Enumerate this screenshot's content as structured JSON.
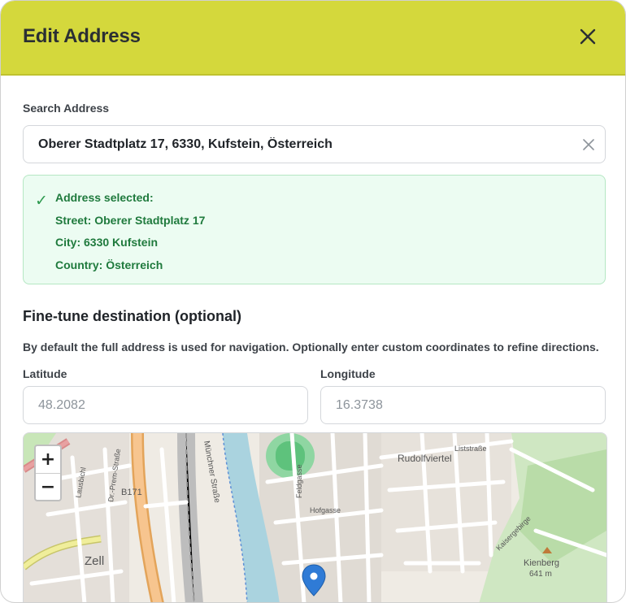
{
  "dialog": {
    "title": "Edit Address",
    "close_icon": "close-icon"
  },
  "search": {
    "label": "Search Address",
    "value": "Oberer Stadtplatz 17, 6330, Kufstein, Österreich",
    "clear_icon": "clear-icon"
  },
  "selection": {
    "heading": "Address selected:",
    "street": "Street: Oberer Stadtplatz 17",
    "city": "City: 6330 Kufstein",
    "country": "Country: Österreich",
    "check_icon": "check-icon"
  },
  "finetune": {
    "heading": "Fine-tune destination (optional)",
    "description": "By default the full address is used for navigation. Optionally enter custom coordinates to refine directions.",
    "latitude_label": "Latitude",
    "latitude_placeholder": "48.2082",
    "longitude_label": "Longitude",
    "longitude_placeholder": "16.3738"
  },
  "map": {
    "zoom_in": "+",
    "zoom_out": "−",
    "labels": {
      "b171": "B171",
      "zell": "Zell",
      "rudolfviertel": "Rudolfviertel",
      "kienberg": "Kienberg",
      "kienberg_elev": "641 m",
      "hofgasse": "Hofgasse",
      "feldgasse": "Feldgasse",
      "muenchner": "Münchner Straße",
      "lausbichl": "Lausbichl",
      "dr_prem": "Dr.-Prem-Straße",
      "liststrasse": "Liststraße",
      "kaisergebirge": "Kaisergebirge"
    }
  },
  "colors": {
    "header": "#d4d83c",
    "success_bg": "#ecfcf2",
    "success_border": "#b5e7c3",
    "success_text": "#1f7a3d",
    "marker": "#2f7bd6"
  }
}
